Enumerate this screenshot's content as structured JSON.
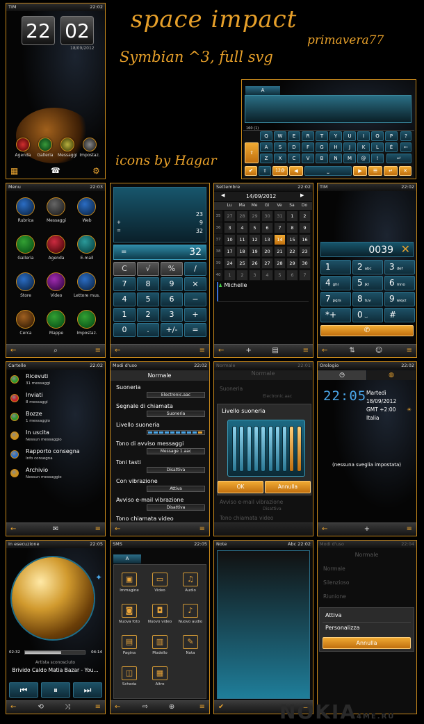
{
  "title": "space impact",
  "author": "primavera77",
  "platform": "Symbian ^3, full svg",
  "icons_credit": "icons by Hagar",
  "watermark": "NOKIA 4ME RU",
  "status": {
    "carrier": "TIM",
    "t1": "22:02",
    "t2": "22:03",
    "t4": "22:02",
    "t5": "22:02",
    "t6": "22:02",
    "t7": "22:02",
    "t8": "22:01",
    "t9": "22:02",
    "t10": "22:05",
    "t11": "22:05",
    "t12": "22:02",
    "t13": "22:04"
  },
  "home": {
    "hour": "22",
    "minute": "02",
    "date": "18/09/2012",
    "apps": [
      "Agenda",
      "Galleria",
      "Messaggi",
      "Impostaz."
    ]
  },
  "keyboard": {
    "tab": "A",
    "row1": [
      "Q",
      "W",
      "E",
      "R",
      "T",
      "Y",
      "U",
      "I",
      "O",
      "P"
    ],
    "row2": [
      "A",
      "S",
      "D",
      "F",
      "G",
      "H",
      "J",
      "K",
      "L",
      "É"
    ],
    "row3": [
      "Z",
      "X",
      "C",
      "V",
      "B",
      "N",
      "M",
      "@",
      "!"
    ],
    "side": "?",
    "num": "12@",
    "counter": "160 (1)"
  },
  "menu": {
    "title": "Menu",
    "items": [
      "Rubrica",
      "Messaggi",
      "Web",
      "Galleria",
      "Agenda",
      "E-mail",
      "Store",
      "Video",
      "Lettore mus.",
      "Cerca",
      "Mappe",
      "Impostaz."
    ]
  },
  "calc": {
    "v1": "23",
    "v2": "9",
    "v3": "32",
    "op1": "+",
    "op2": "=",
    "display": "32",
    "result_op": "=",
    "keys": [
      [
        "C",
        "√",
        "%",
        "/"
      ],
      [
        "7",
        "8",
        "9",
        "×"
      ],
      [
        "4",
        "5",
        "6",
        "−"
      ],
      [
        "1",
        "2",
        "3",
        "+"
      ],
      [
        "0",
        ".",
        "+/-",
        "="
      ]
    ]
  },
  "calendar": {
    "month": "Settembre",
    "date": "14/09/2012",
    "days": [
      "Lu",
      "Ma",
      "Me",
      "Gi",
      "Ve",
      "Sa",
      "Do"
    ],
    "weeks": [
      "35",
      "36",
      "37",
      "38",
      "39",
      "40"
    ],
    "cells": [
      [
        "27",
        "28",
        "29",
        "30",
        "31",
        "1",
        "2"
      ],
      [
        "3",
        "4",
        "5",
        "6",
        "7",
        "8",
        "9"
      ],
      [
        "10",
        "11",
        "12",
        "13",
        "14",
        "15",
        "16"
      ],
      [
        "17",
        "18",
        "19",
        "20",
        "21",
        "22",
        "23"
      ],
      [
        "24",
        "25",
        "26",
        "27",
        "28",
        "29",
        "30"
      ],
      [
        "1",
        "2",
        "3",
        "4",
        "5",
        "6",
        "7"
      ]
    ],
    "event": "Michelle"
  },
  "dialer": {
    "number": "0039",
    "keys": [
      [
        "1",
        ""
      ],
      [
        "2",
        "abc"
      ],
      [
        "3",
        "def"
      ],
      [
        "4",
        "ghi"
      ],
      [
        "5",
        "jkl"
      ],
      [
        "6",
        "mno"
      ],
      [
        "7",
        "pqrs"
      ],
      [
        "8",
        "tuv"
      ],
      [
        "9",
        "wxyz"
      ],
      [
        "*+",
        ""
      ],
      [
        "0",
        "⌴"
      ],
      [
        "#",
        ""
      ]
    ]
  },
  "folders": {
    "title": "Cartelle",
    "items": [
      {
        "name": "Ricevuti",
        "sub": "31 messaggi"
      },
      {
        "name": "Inviati",
        "sub": "8 messaggi"
      },
      {
        "name": "Bozze",
        "sub": "1 messaggio"
      },
      {
        "name": "In uscita",
        "sub": "Nessun messaggio"
      },
      {
        "name": "Rapporto consegna",
        "sub": "Info consegna"
      },
      {
        "name": "Archivio",
        "sub": "Nessun messaggio"
      }
    ]
  },
  "profile": {
    "title": "Modi d'uso",
    "mode": "Normale",
    "rows": [
      {
        "label": "Suoneria",
        "value": "Electronic.aac"
      },
      {
        "label": "Segnale di chiamata",
        "value": "Suoneria"
      },
      {
        "label": "Livello suoneria",
        "value": ""
      },
      {
        "label": "Tono di avviso messaggi",
        "value": "Message 1.aac"
      },
      {
        "label": "Toni tasti",
        "value": "Disattiva"
      },
      {
        "label": "Con vibrazione",
        "value": "Attiva"
      },
      {
        "label": "Avviso e-mail vibrazione",
        "value": "Disattiva"
      },
      {
        "label": "Tono chiamata video",
        "value": ""
      }
    ]
  },
  "volume": {
    "header": "Normale",
    "bg1": "Suoneria",
    "bg1v": "Electronic.aac",
    "title": "Livello suoneria",
    "ok": "OK",
    "cancel": "Annulla",
    "bg2": "Avviso e-mail vibrazione",
    "bg2v": "Disattiva",
    "bg3": "Tono chiamata video",
    "bars": 10,
    "level": 2
  },
  "clock": {
    "title": "Orologio",
    "time": "22:05",
    "day": "Martedì",
    "date": "18/09/2012",
    "tz": "GMT +2:00",
    "country": "Italia",
    "alarm": "(nessuna sveglia impostata)"
  },
  "music": {
    "title": "In esecuzione",
    "elapsed": "02:32",
    "total": "04:14",
    "artist": "Artista sconosciuto",
    "song": "Brivido Caldo Matia Bazar - You...",
    "progress": 0.6
  },
  "sms": {
    "title": "SMS",
    "tab": "A",
    "items": [
      "Immagine",
      "Video",
      "Audio",
      "Nuova foto",
      "Nuovo video",
      "Nuovo audio",
      "Pagina",
      "Modello",
      "Nota",
      "Scheda",
      "Altro"
    ]
  },
  "notes": {
    "title": "Note",
    "abc": "Abc"
  },
  "modes": {
    "title": "Modi d'uso",
    "header": "Normale",
    "items": [
      "Normale",
      "Silenzioso",
      "Riunione"
    ],
    "menu": [
      "Attiva",
      "Personalizza"
    ],
    "cancel": "Annulla"
  }
}
